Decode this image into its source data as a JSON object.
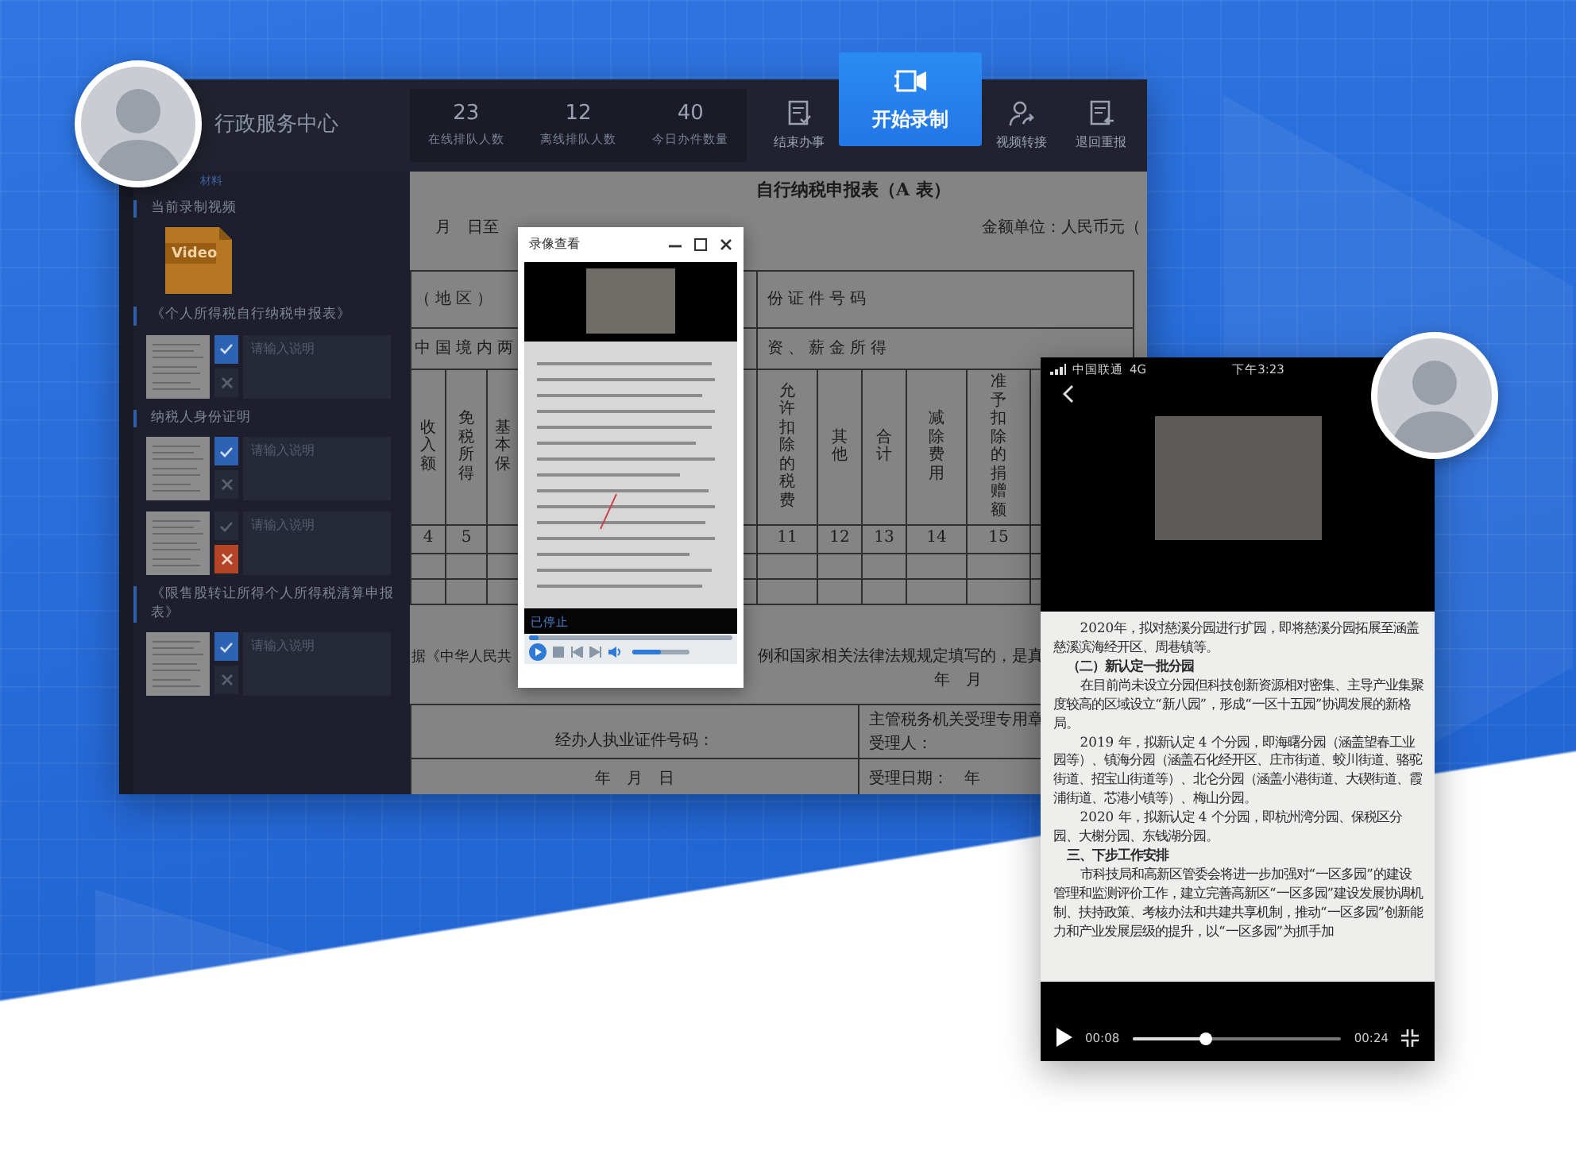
{
  "app": {
    "title": "行政服务中心",
    "stats": [
      {
        "value": "23",
        "label": "在线排队人数"
      },
      {
        "value": "12",
        "label": "离线排队人数"
      },
      {
        "value": "40",
        "label": "今日办件数量"
      }
    ],
    "actions": [
      {
        "kind": "finish",
        "label": "结束办事",
        "selected": false
      },
      {
        "kind": "record",
        "label": "开始录制",
        "selected": true
      },
      {
        "kind": "transfer",
        "label": "视频转接",
        "selected": false
      },
      {
        "kind": "return",
        "label": "退回重报",
        "selected": false
      }
    ]
  },
  "sidebar": {
    "header": "材料",
    "video_section": {
      "title": "当前录制视频",
      "file_label": "Video"
    },
    "sections": [
      {
        "title": "《个人所得税自行纳税申报表》",
        "items": [
          {
            "approved": true,
            "rejected": false,
            "placeholder": "请输入说明"
          }
        ]
      },
      {
        "title": "纳税人身份证明",
        "items": [
          {
            "approved": true,
            "rejected": false,
            "placeholder": "请输入说明"
          },
          {
            "approved": false,
            "rejected": true,
            "placeholder": "请输入说明"
          }
        ]
      },
      {
        "title": "《限售股转让所得个人所得税清算申报表》",
        "items": [
          {
            "approved": true,
            "rejected": false,
            "placeholder": "请输入说明"
          }
        ]
      }
    ]
  },
  "document": {
    "title": "自行纳税申报表（A 表）",
    "period": "月　日至",
    "unit": "金额单位：人民币元（",
    "info_rows": [
      [
        "（地区）",
        "份证件号码"
      ],
      [
        "中国境内两",
        "资、薪金所得"
      ]
    ],
    "rows": [
      [
        {
          "text": "收入额"
        },
        {
          "text": "免税所得"
        },
        {
          "text": "基本保"
        },
        {},
        {
          "text": "允许扣除的税费"
        },
        {
          "text": "其他"
        },
        {
          "text": "合计"
        },
        {
          "text": "减除费用"
        },
        {
          "text": "准予扣除的捐赠额"
        },
        {}
      ],
      [
        {
          "text": "4"
        },
        {
          "text": "5"
        },
        {},
        {},
        {
          "text": "11"
        },
        {
          "text": "12"
        },
        {
          "text": "13"
        },
        {
          "text": "14"
        },
        {
          "text": "15"
        },
        {}
      ],
      [
        {},
        {},
        {},
        {},
        {},
        {},
        {},
        {},
        {},
        {}
      ],
      [
        {},
        {},
        {},
        {},
        {},
        {},
        {},
        {},
        {},
        {}
      ]
    ],
    "declaration_left": "据《中华人民共",
    "declaration_right": "例和国家相关法律法规规定填写的，是真",
    "sign_date": "年　月",
    "footer_rows": [
      {
        "left": "经办人执业证件号码：",
        "right": [
          "主管税务机关受理专用章",
          "受理人："
        ]
      },
      {
        "left": "年　月　日",
        "right": [
          "受理日期：　年"
        ]
      }
    ]
  },
  "popup": {
    "title": "录像查看",
    "status": "已停止",
    "progress": {
      "level": 0.05
    },
    "volume": {
      "level": 0.5
    }
  },
  "phone": {
    "carrier": "中国联通",
    "network": "4G",
    "time": "下午3:23",
    "paragraphs": [
      {
        "kind": "body",
        "text": "2020年，拟对慈溪分园进行扩园，即将慈溪分园拓展至涵盖慈溪滨海经开区、周巷镇等。"
      },
      {
        "kind": "heading",
        "text": "（二）新认定一批分园"
      },
      {
        "kind": "body",
        "text": "在目前尚未设立分园但科技创新资源相对密集、主导产业集聚度较高的区域设立“新八园”，形成“一区十五园”协调发展的新格局。"
      },
      {
        "kind": "body",
        "text": "2019 年，拟新认定 4 个分园，即海曙分园（涵盖望春工业园等）、镇海分园（涵盖石化经开区、庄市街道、蛟川街道、骆驼街道、招宝山街道等）、北仑分园（涵盖小港街道、大碶街道、霞浦街道、芯港小镇等）、梅山分园。"
      },
      {
        "kind": "body",
        "text": "2020 年，拟新认定 4 个分园，即杭州湾分园、保税区分园、大榭分园、东钱湖分园。"
      },
      {
        "kind": "heading",
        "text": "三、下步工作安排"
      },
      {
        "kind": "body",
        "text": "市科技局和高新区管委会将进一步加强对“一区多园”的建设管理和监测评价工作，建立完善高新区“一区多园”建设发展协调机制、扶持政策、考核办法和共建共享机制，推动“一区多园”创新能力和产业发展层级的提升，以“一区多园”为抓手加"
      }
    ],
    "elapsed": "00:08",
    "duration": "00:24",
    "progress": {
      "level": 0.35
    }
  }
}
